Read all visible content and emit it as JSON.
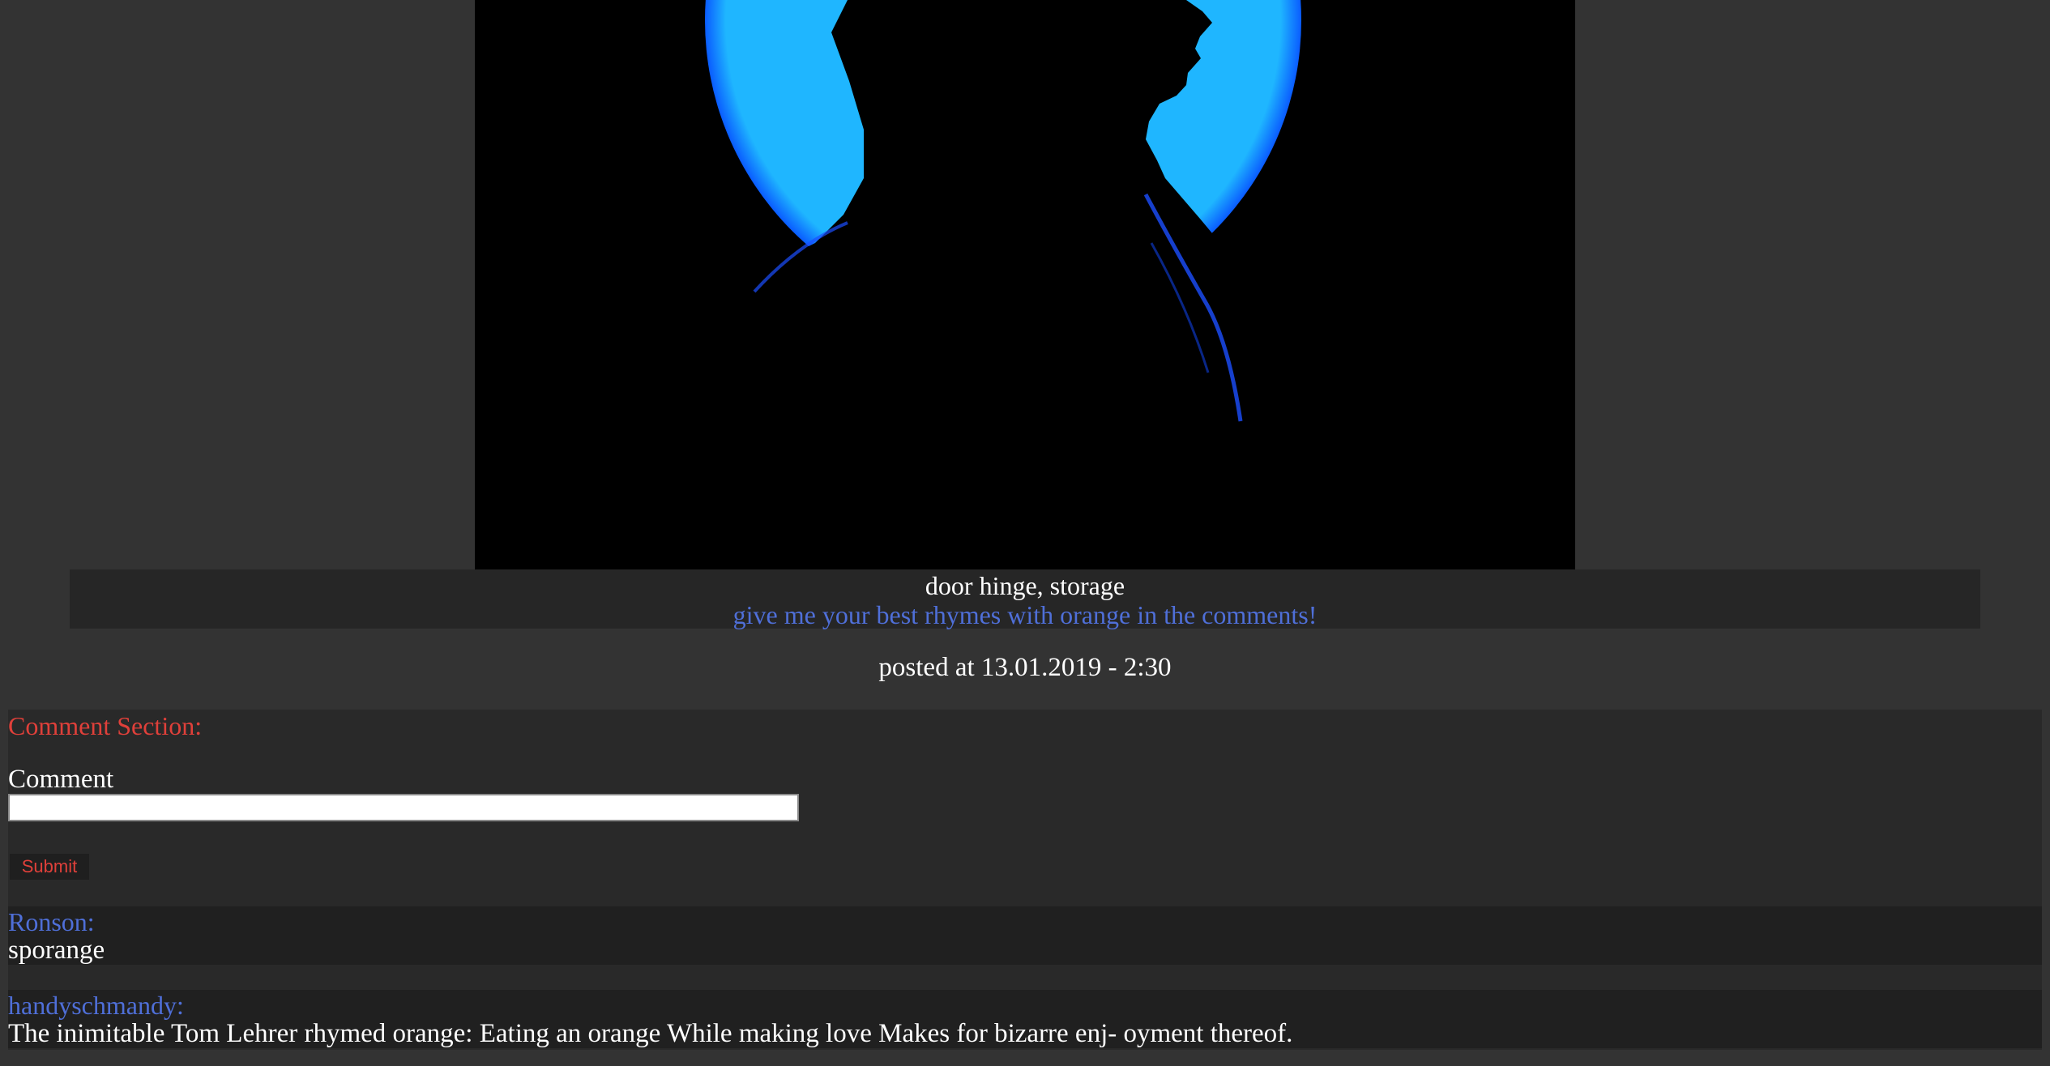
{
  "post": {
    "caption_title": "door hinge, storage",
    "caption_description": "give me your best rhymes with orange in the comments!",
    "posted_at": "posted at 13.01.2019 - 2:30"
  },
  "comment_section": {
    "heading": "Comment Section:",
    "form": {
      "label": "Comment",
      "input_value": "",
      "submit_label": "Submit"
    },
    "comments": [
      {
        "author": "Ronson:",
        "text": "sporange"
      },
      {
        "author": "handyschmandy:",
        "text": "The inimitable Tom Lehrer rhymed orange: Eating an orange While making love Makes for bizarre enj- oyment thereof."
      }
    ]
  },
  "colors": {
    "page_background": "#333333",
    "panel_background": "#292929",
    "accent_red": "#e0403a",
    "accent_blue": "#4f6fd8",
    "hero_glow": "#1fb6ff"
  },
  "icons": {
    "hero_image": "silhouette-profile-blue-circle-image"
  }
}
